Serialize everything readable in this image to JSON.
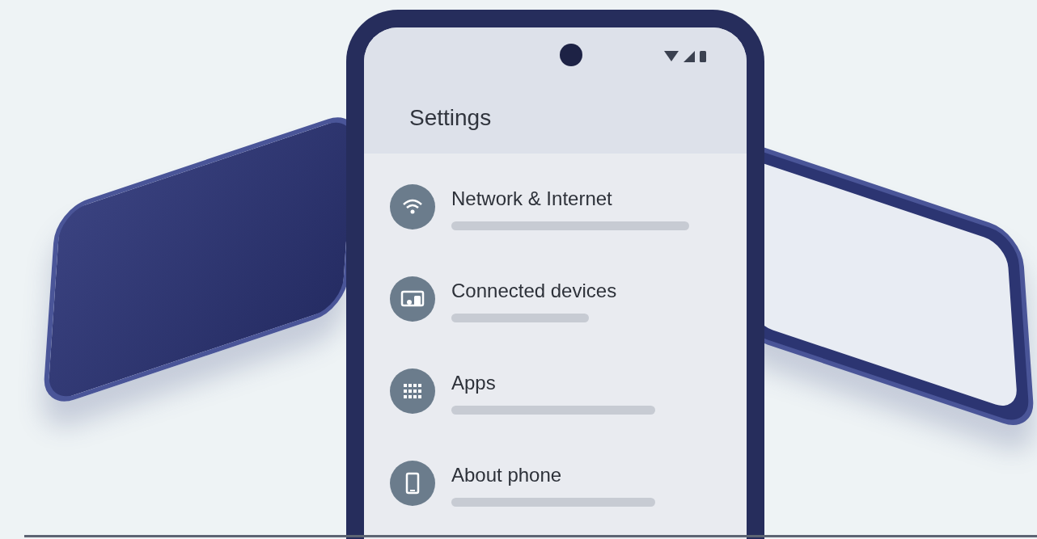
{
  "screen": {
    "title": "Settings"
  },
  "items": [
    {
      "label": "Network & Internet",
      "kind": "wifi"
    },
    {
      "label": "Connected devices",
      "kind": "devices"
    },
    {
      "label": "Apps",
      "kind": "grid"
    },
    {
      "label": "About phone",
      "kind": "phone"
    }
  ]
}
